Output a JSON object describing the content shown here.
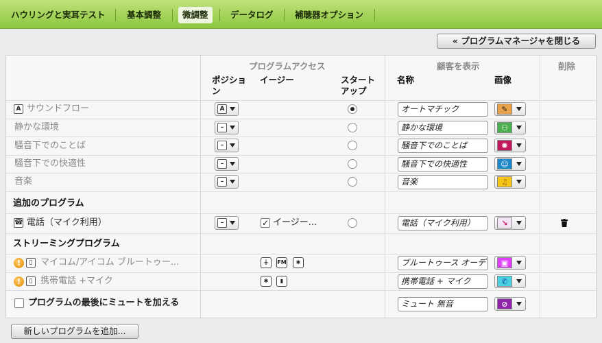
{
  "tabs": [
    {
      "label": "ハウリングと実耳テスト",
      "active": false
    },
    {
      "label": "基本調整",
      "active": false
    },
    {
      "label": "微調整",
      "active": true
    },
    {
      "label": "データログ",
      "active": false
    },
    {
      "label": "補聴器オプション",
      "active": false
    }
  ],
  "close_manager_label": "« プログラムマネージャを閉じる",
  "headers": {
    "program_access": "プログラムアクセス",
    "position": "ポジション",
    "easy": "イージー",
    "startup": "スタートアップ",
    "customer_display": "顧客を表示",
    "name": "名称",
    "image": "画像",
    "delete": "削除"
  },
  "programs": [
    {
      "badge": "A",
      "name": "サウンドフロー",
      "position": "A",
      "startup": true,
      "display_name": "オートマチック",
      "image_icon": "sound-flow-icon",
      "image_color": "#e8a24a",
      "image_glyph": "✎"
    },
    {
      "name": "静かな環境",
      "position": "–",
      "startup": false,
      "display_name": "静かな環境",
      "image_icon": "quiet-environment-icon",
      "image_color": "#4caf50",
      "image_glyph": "⚇"
    },
    {
      "name": "騒音下でのことば",
      "position": "–",
      "startup": false,
      "display_name": "騒音下でのことば",
      "image_icon": "speech-in-noise-icon",
      "image_color": "#c2185b",
      "image_glyph": "✺"
    },
    {
      "name": "騒音下での快適性",
      "position": "–",
      "startup": false,
      "display_name": "騒音下での快適性",
      "image_icon": "comfort-in-noise-icon",
      "image_color": "#1e88c8",
      "image_glyph": "☺"
    },
    {
      "name": "音楽",
      "position": "–",
      "startup": false,
      "display_name": "音楽",
      "image_icon": "music-icon",
      "image_color": "#f5c518",
      "image_glyph": "♫"
    }
  ],
  "additional": {
    "section_title": "追加のプログラム",
    "program": {
      "name": "電話（マイク利用）",
      "position": "–",
      "easy_checked": true,
      "easy_label": "イージー...",
      "startup": false,
      "display_name": "電話（マイク利用）",
      "image_icon": "phone-icon",
      "image_color": "#7b1fa2",
      "image_glyph": "↘"
    }
  },
  "streaming": {
    "section_title": "ストリーミングプログラム",
    "programs": [
      {
        "name": "マイコム/アイコム ブルートゥー...",
        "display_name": "ブルートゥース オーデ",
        "image_icon": "bluetooth-device-icon",
        "image_color": "#e040fb",
        "image_glyph": "▣"
      },
      {
        "name": "携帯電話 +マイク",
        "display_name": "携帯電話 + マイク",
        "image_icon": "mobile-phone-icon",
        "image_color": "#4dd0e1",
        "image_glyph": "✆"
      }
    ]
  },
  "mute": {
    "label": "プログラムの最後にミュートを加える",
    "checked": false,
    "display_name": "ミュート 無音",
    "image_icon": "mute-icon",
    "image_color": "#8e24aa",
    "image_glyph": "⊘"
  },
  "add_program_label": "新しいプログラムを追加..."
}
